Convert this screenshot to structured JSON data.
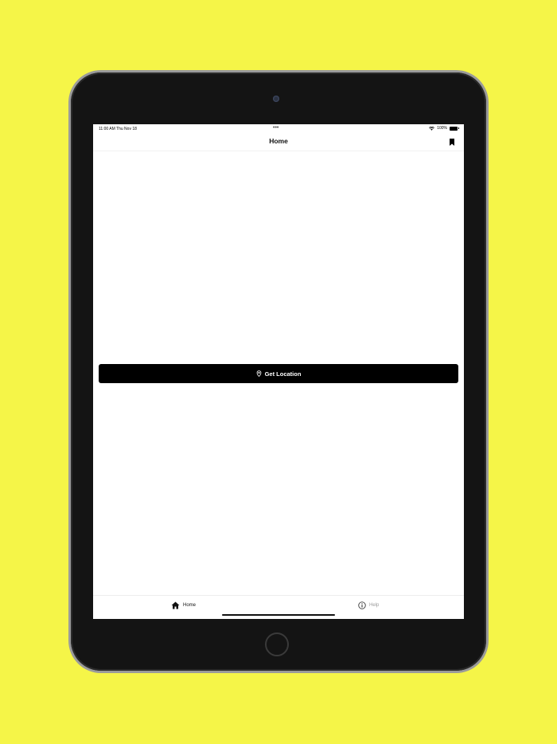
{
  "status_bar": {
    "time_date": "11:00 AM   Thu Nov 18",
    "dots": "•••",
    "battery": "100%"
  },
  "nav": {
    "title": "Home"
  },
  "main": {
    "button_label": "Get Location"
  },
  "tabs": [
    {
      "label": "Home",
      "icon": "house-icon",
      "selected": true
    },
    {
      "label": "Help",
      "icon": "info-icon",
      "selected": false
    }
  ],
  "colors": {
    "background": "#f5f548",
    "accent": "#000000",
    "inactive_tab": "#9a9a9a"
  }
}
